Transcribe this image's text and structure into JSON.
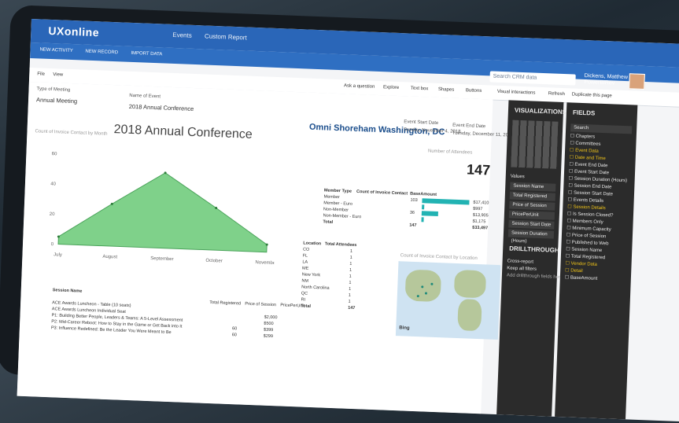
{
  "app": {
    "logo": "UXonline",
    "nav": [
      "Events",
      "Custom Report"
    ],
    "subbar": [
      "NEW ACTIVITY",
      "NEW RECORD",
      "IMPORT DATA"
    ],
    "search_placeholder": "Search CRM data",
    "user_name": "Dickens, Matthew",
    "user_org": "PowerBIRev"
  },
  "toolbar": {
    "left": [
      "File",
      "View"
    ],
    "items": [
      "Ask a question",
      "Explore",
      "Text box",
      "Shapes",
      "Buttons",
      "Visual interactions",
      "Refresh",
      "Duplicate this page"
    ]
  },
  "filters": {
    "type_label": "Type of Meeting",
    "type_value": "Annual Meeting",
    "event_label": "Name of Event",
    "event_value": "2018 Annual Conference"
  },
  "report": {
    "title": "2018 Annual Conference",
    "venue": "Omni Shoreham Washington, DC",
    "start_label": "Event Start Date",
    "end_label": "Event End Date",
    "start_value": "Sunday, November 4, 2018",
    "end_value": "Tuesday, December 11, 2018",
    "attendees_label": "Number of Attendees",
    "attendees_value": "147",
    "area_chart_title": "Count of Invoice Contact by Month",
    "map_title": "Count of Invoice Contact by Location",
    "map_brand": "Bing"
  },
  "chart_data": {
    "type": "area",
    "categories": [
      "July",
      "August",
      "September",
      "October",
      "November"
    ],
    "values": [
      5,
      28,
      50,
      28,
      5
    ],
    "ylim": [
      0,
      60
    ],
    "yticks": [
      "60",
      "40",
      "20",
      "0"
    ]
  },
  "member_table": {
    "headers": [
      "Member Type",
      "Count of Invoice Contact",
      "BaseAmount"
    ],
    "rows": [
      [
        "Member",
        "103",
        "$17,410"
      ],
      [
        "Member - Euro",
        "",
        "$997"
      ],
      [
        "Non-Member",
        "36",
        "$13,905"
      ],
      [
        "Non-Member - Euro",
        "",
        "$1,175"
      ]
    ],
    "total": [
      "Total",
      "147",
      "$33,497"
    ],
    "bar_fractions": [
      1.0,
      0.05,
      0.35,
      0.05
    ]
  },
  "location_table": {
    "headers": [
      "Location",
      "Total Attendees"
    ],
    "rows": [
      [
        "CO",
        "1"
      ],
      [
        "FL",
        "1"
      ],
      [
        "LA",
        "1"
      ],
      [
        "ME",
        "1"
      ],
      [
        "New York",
        "1"
      ],
      [
        "NM",
        "1"
      ],
      [
        "North Carolina",
        "1"
      ],
      [
        "QC",
        "1"
      ],
      [
        "RI",
        "1"
      ]
    ],
    "total": [
      "Total",
      "147"
    ]
  },
  "session_table": {
    "header": "Session Name",
    "cols": [
      "Total Registered",
      "Price of Session",
      "PricePerUnit"
    ],
    "rows": [
      "ACE Awards Luncheon - Table (10 seats)",
      "ACE Awards Luncheon Individual Seat",
      "P1: Building Better People, Leaders & Teams: A 5-Level Assessment",
      "P2: Mid-Career Reboot: How to Stay in the Game or Get Back into It",
      "P3: Influence Redefined: Be the Leader You Were Meant to Be"
    ],
    "values": [
      "$2,000",
      "$500",
      "$399",
      "$299"
    ],
    "nums": [
      "",
      "",
      "",
      "60",
      "60"
    ]
  },
  "viz_panel": {
    "title": "VISUALIZATIONS",
    "values_label": "Values",
    "values": [
      "Session Name",
      "Total Registered",
      "Price of Session",
      "PricePerUnit",
      "Session Start Date",
      "Session Duration (Hours)"
    ],
    "drill": "DRILLTHROUGH",
    "cross": "Cross-report",
    "keep": "Keep all filters",
    "hint": "Add drillthrough fields here"
  },
  "fields_panel": {
    "title": "FIELDS",
    "search": "Search",
    "items": [
      "Chapters",
      "Committees",
      "Event Data",
      "Date and Time",
      "Event End Date",
      "Event Start Date",
      "Session Duration (Hours)",
      "Session End Date",
      "Session Start Date",
      "Events Details",
      "Session Details",
      "Is Session Closed?",
      "Members Only",
      "Minimum Capacity",
      "Price of Session",
      "Published to Web",
      "Session Name",
      "Total Registered",
      "Vendor Data",
      "Detail",
      "BaseAmount"
    ]
  },
  "filters_tab": "FILTERS"
}
